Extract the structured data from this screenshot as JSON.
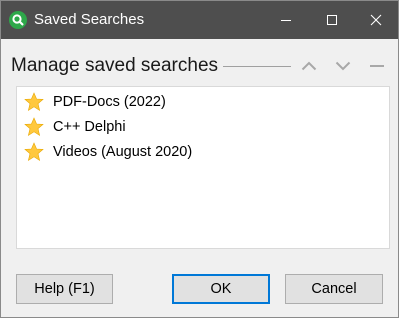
{
  "window": {
    "title": "Saved Searches"
  },
  "header": {
    "title": "Manage saved searches"
  },
  "list": {
    "items": [
      {
        "label": "PDF-Docs (2022)",
        "icon": "star-icon"
      },
      {
        "label": "C++ Delphi",
        "icon": "star-icon"
      },
      {
        "label": "Videos (August 2020)",
        "icon": "star-icon"
      }
    ]
  },
  "buttons": {
    "help": "Help (F1)",
    "ok": "OK",
    "cancel": "Cancel"
  },
  "colors": {
    "titlebar": "#4e4e4e",
    "accent": "#0078d7",
    "star": "#ffc83d",
    "app_icon": "#2ea84a"
  }
}
